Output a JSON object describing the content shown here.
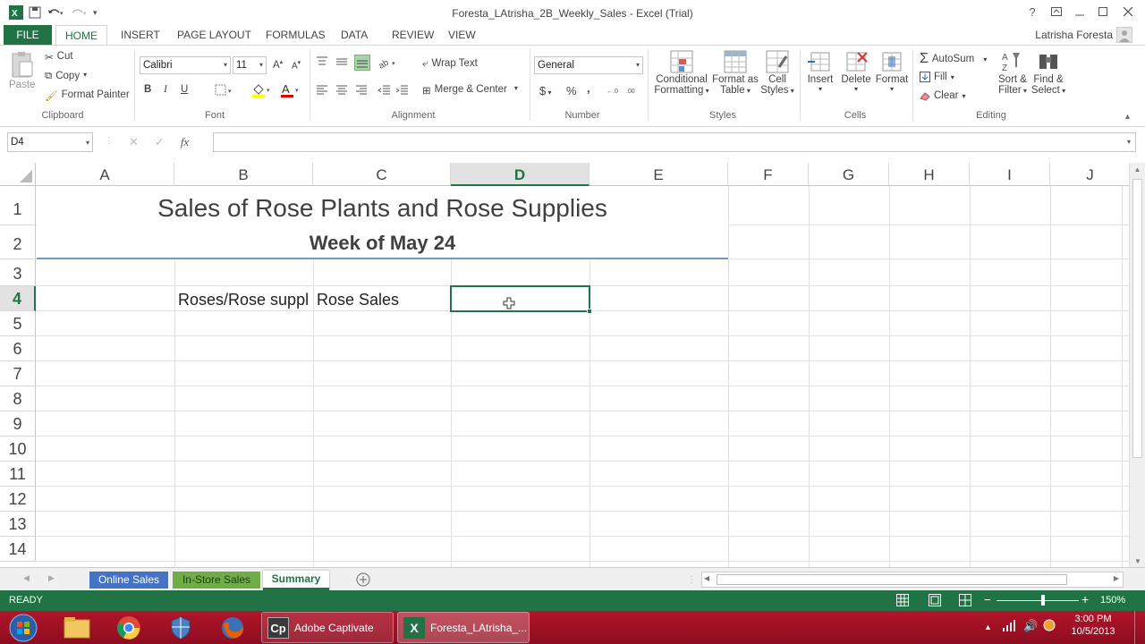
{
  "window": {
    "title": "Foresta_LAtrisha_2B_Weekly_Sales - Excel (Trial)",
    "help": "?",
    "user": "Latrisha Foresta"
  },
  "tabs": [
    "FILE",
    "HOME",
    "INSERT",
    "PAGE LAYOUT",
    "FORMULAS",
    "DATA",
    "REVIEW",
    "VIEW"
  ],
  "ribbon": {
    "clipboard": {
      "label": "Clipboard",
      "paste": "Paste",
      "cut": "Cut",
      "copy": "Copy",
      "format_painter": "Format Painter"
    },
    "font": {
      "label": "Font",
      "name": "Calibri",
      "size": "11",
      "bold": "B",
      "italic": "I",
      "underline": "U"
    },
    "alignment": {
      "label": "Alignment",
      "wrap_text": "Wrap Text",
      "merge_center": "Merge & Center"
    },
    "number": {
      "label": "Number",
      "format": "General",
      "currency": "$",
      "percent": "%",
      "comma": ","
    },
    "styles": {
      "label": "Styles",
      "conditional_1": "Conditional",
      "conditional_2": "Formatting",
      "format_as_1": "Format as",
      "format_as_2": "Table",
      "cell_styles_1": "Cell",
      "cell_styles_2": "Styles"
    },
    "cells": {
      "label": "Cells",
      "insert": "Insert",
      "delete": "Delete",
      "format": "Format"
    },
    "editing": {
      "label": "Editing",
      "autosum": "AutoSum",
      "fill": "Fill",
      "clear": "Clear",
      "sort_1": "Sort &",
      "sort_2": "Filter",
      "find_1": "Find &",
      "find_2": "Select"
    }
  },
  "formula_bar": {
    "name_box": "D4",
    "fx": "fx",
    "content": ""
  },
  "columns": [
    "A",
    "B",
    "C",
    "D",
    "E",
    "F",
    "G",
    "H",
    "I",
    "J"
  ],
  "rows": [
    "1",
    "2",
    "3",
    "4",
    "5",
    "6",
    "7",
    "8",
    "9",
    "10",
    "11",
    "12",
    "13",
    "14"
  ],
  "cells": {
    "title": "Sales of Rose Plants and Rose Supplies",
    "subtitle": "Week of May 24",
    "b4": "Roses/Rose suppl",
    "c4": "Rose Sales"
  },
  "selected_cell": "D4",
  "sheets": [
    {
      "name": "Online Sales",
      "color": "#4472c4"
    },
    {
      "name": "In-Store Sales",
      "color": "#70ad47"
    },
    {
      "name": "Summary",
      "color": "#ffffff"
    }
  ],
  "active_sheet": "Summary",
  "status": {
    "mode": "READY",
    "zoom": "150%"
  },
  "taskbar": {
    "apps": [
      "Adobe Captivate",
      "Foresta_LAtrisha_..."
    ],
    "time": "3:00 PM",
    "date": "10/5/2013"
  }
}
